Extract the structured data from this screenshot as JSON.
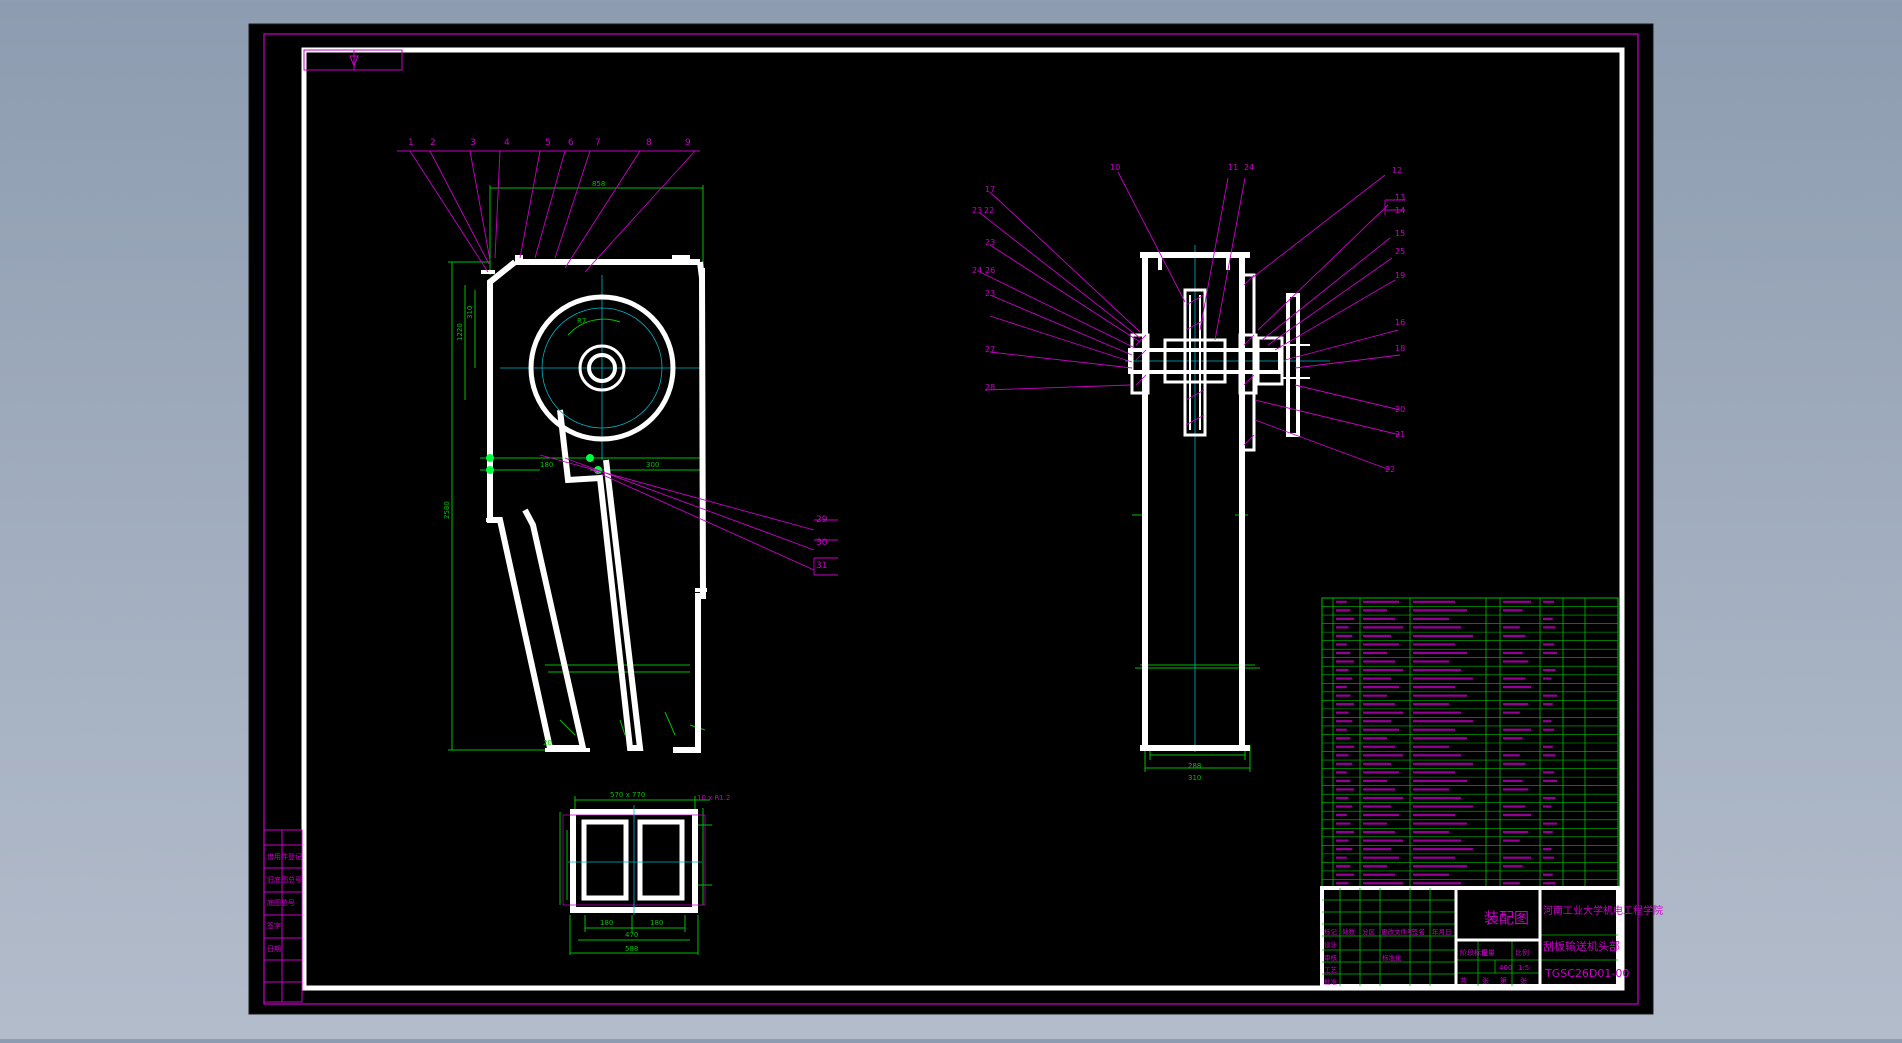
{
  "colors": {
    "background_top": "#8d9cb0",
    "background_bottom": "#b3bccb",
    "sheet": "#000000",
    "outline": "#ffffff",
    "dimension": "#00c000",
    "leader": "#c800c8",
    "centerline": "#00b4c8",
    "highlight": "#00ff40"
  },
  "icons": {
    "corner_mark": "projection-symbol-icon"
  },
  "left_view": {
    "balloons": [
      "1",
      "2",
      "3",
      "4",
      "5",
      "6",
      "7",
      "8",
      "9"
    ],
    "lower_balloons": [
      "29",
      "30",
      "31"
    ],
    "dims": {
      "top_width": "858",
      "left_height": "1220",
      "inner_height": "310",
      "total_height": "2580",
      "angle": "R7",
      "mid_left": "180",
      "mid_right": "300",
      "bottom": "20"
    }
  },
  "section_view": {
    "top_label": "570 x 770",
    "side_label": "10 x R1.2",
    "bottom_inner": [
      "180",
      "180"
    ],
    "bottom_mid": "470",
    "bottom_outer": "588"
  },
  "right_view": {
    "balloons_right": [
      "12",
      "13",
      "14",
      "15",
      "25",
      "19",
      "16",
      "18",
      "20",
      "21",
      "22"
    ],
    "balloons_left": [
      "17",
      "23",
      "22",
      "23",
      "24",
      "26",
      "23",
      "27",
      "28"
    ],
    "top_balloons": [
      "10",
      "11",
      "24"
    ],
    "bottom_dims": [
      "288",
      "310"
    ]
  },
  "title_block": {
    "drawing_title": "装配图",
    "school": "河南工业大学机电工程学院",
    "product": "刮板输送机头部",
    "drawing_no": "TGSC26D01-00",
    "cells": [
      "阶段标记",
      "重量",
      "比例",
      "共",
      "张",
      "第",
      "张"
    ],
    "scale_values": [
      "400",
      "1:5"
    ],
    "left_labels": [
      "标记",
      "处数",
      "分区",
      "更改文件号",
      "签名",
      "年月日",
      "设计",
      "审核",
      "工艺",
      "批准",
      "标准化"
    ]
  },
  "side_strip": [
    "借用件登记",
    "旧底图总号",
    "底图总号",
    "签字",
    "日期"
  ],
  "parts_table": {
    "rows": 34
  }
}
